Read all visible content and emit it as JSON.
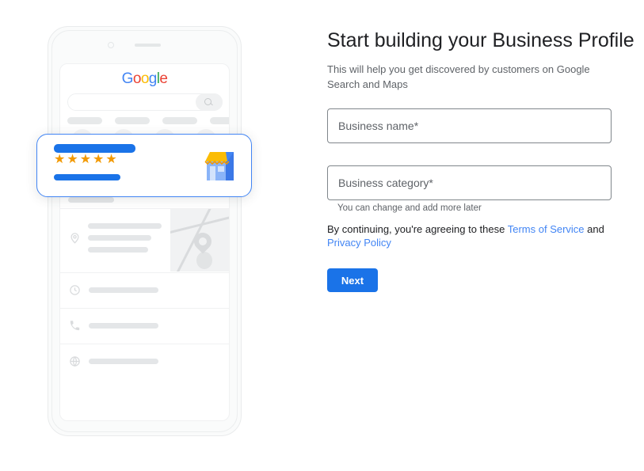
{
  "form": {
    "title": "Start building your Business Profile",
    "subtitle": "This will help you get discovered by customers on Google Search and Maps",
    "fields": [
      {
        "name": "business-name",
        "placeholder": "Business name*",
        "value": ""
      },
      {
        "name": "business-category",
        "placeholder": "Business category*",
        "value": ""
      }
    ],
    "helper_text": "You can change and add more later",
    "legal": {
      "prefix": "By continuing, you're agreeing to these ",
      "terms_link": "Terms of Service",
      "conjunction": " and ",
      "privacy_link": "Privacy Policy"
    },
    "next_label": "Next",
    "accent_color": "#1a73e8",
    "link_color": "#4285f4"
  },
  "illustration": {
    "name": "phone-business-profile-illustration",
    "google_logo": {
      "letters": [
        "G",
        "o",
        "o",
        "g",
        "l",
        "e"
      ],
      "colors": [
        "#4285f4",
        "#ea4335",
        "#fbbc05",
        "#4285f4",
        "#34a853",
        "#ea4335"
      ]
    },
    "search_placeholder": "",
    "highlight_card": {
      "stars": "★★★★★",
      "star_count": 5,
      "star_color": "#f29900",
      "bar_color": "#1a73e8",
      "border_color": "#4285f4",
      "icon": "storefront-icon"
    },
    "action_icons": [
      "call-icon",
      "directions-icon",
      "save-icon",
      "share-icon"
    ],
    "detail_rows": [
      {
        "icon": "location-pin-icon"
      },
      {
        "icon": "clock-icon"
      },
      {
        "icon": "phone-icon"
      },
      {
        "icon": "globe-icon"
      }
    ]
  }
}
